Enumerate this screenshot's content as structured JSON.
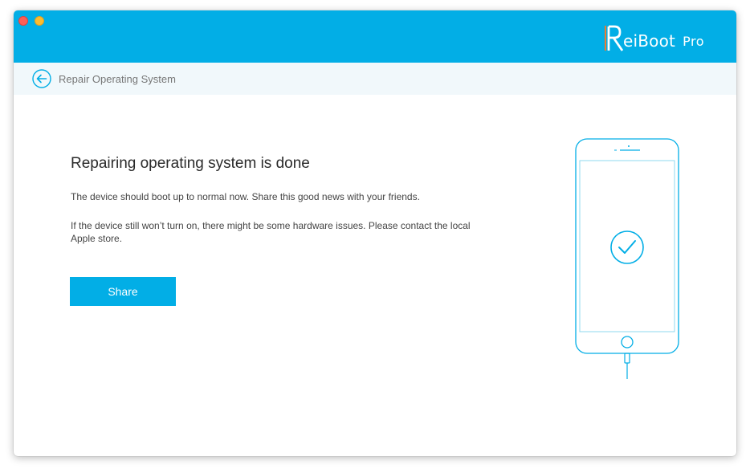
{
  "window": {
    "brand_name": "eiBoot",
    "brand_edition": "Pro",
    "accent_color": "#02aee6"
  },
  "navbar": {
    "back_icon": "arrow-left-circle-icon",
    "title": "Repair Operating System"
  },
  "main": {
    "heading": "Repairing operating system is done",
    "description_1": "The device should boot up to normal now. Share this good news with your friends.",
    "description_2": "If the device still won’t turn on, there might be some hardware issues. Please contact the local Apple store.",
    "share_label": "Share"
  },
  "illustration": {
    "device_icon": "phone-icon",
    "status_icon": "checkmark-circle-icon",
    "cable_icon": "lightning-cable-icon"
  }
}
